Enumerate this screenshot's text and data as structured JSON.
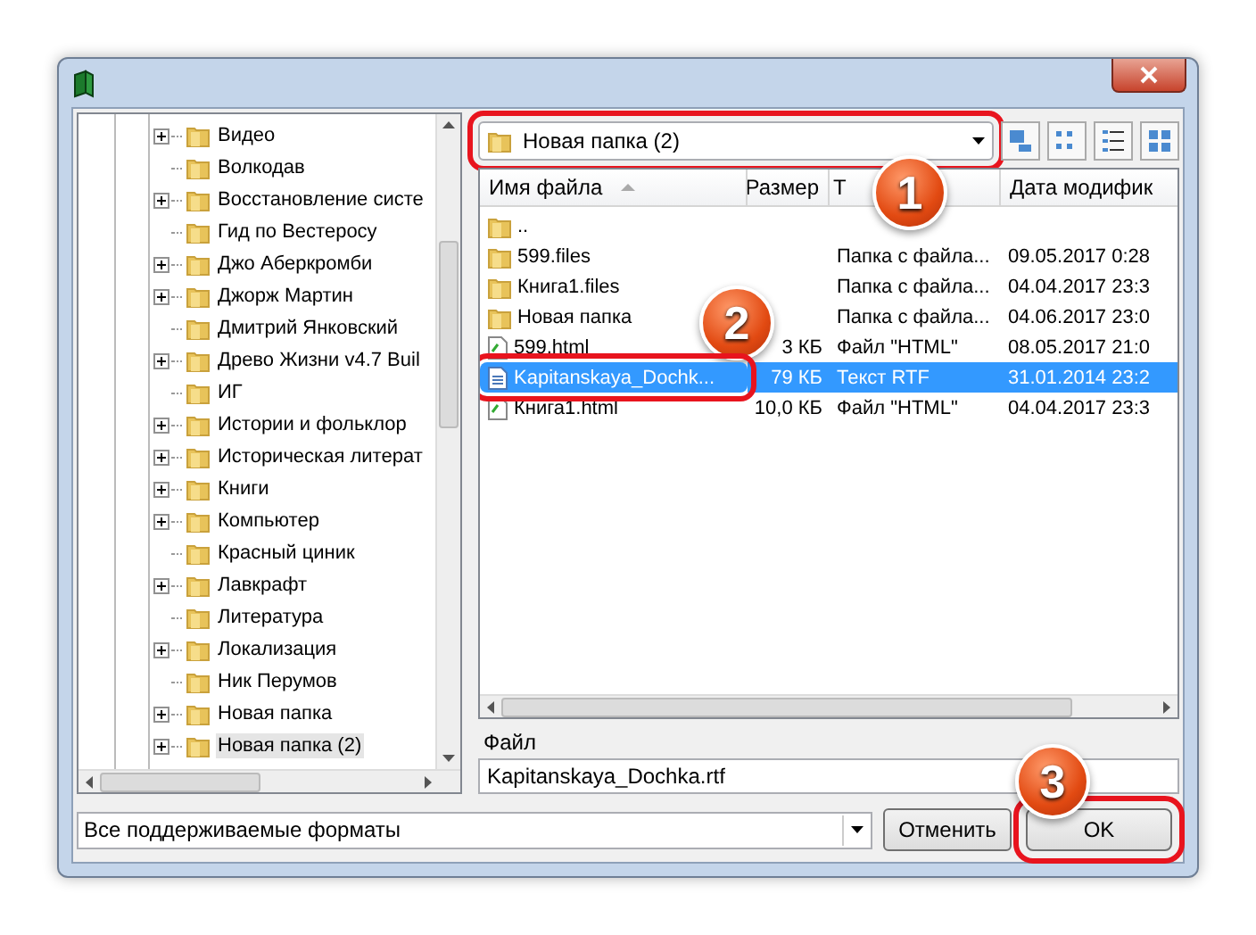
{
  "tree": {
    "items": [
      {
        "label": "Видео",
        "has_children": true,
        "selected": false
      },
      {
        "label": "Волкодав",
        "has_children": false,
        "selected": false
      },
      {
        "label": "Восстановление систе",
        "has_children": true,
        "selected": false
      },
      {
        "label": "Гид по Вестеросу",
        "has_children": false,
        "selected": false
      },
      {
        "label": "Джо Аберкромби",
        "has_children": true,
        "selected": false
      },
      {
        "label": "Джорж Мартин",
        "has_children": true,
        "selected": false
      },
      {
        "label": "Дмитрий Янковский",
        "has_children": false,
        "selected": false
      },
      {
        "label": "Древо Жизни v4.7 Buil",
        "has_children": true,
        "selected": false
      },
      {
        "label": "ИГ",
        "has_children": false,
        "selected": false
      },
      {
        "label": "Истории и фольклор",
        "has_children": true,
        "selected": false
      },
      {
        "label": "Историческая литерат",
        "has_children": true,
        "selected": false
      },
      {
        "label": "Книги",
        "has_children": true,
        "selected": false
      },
      {
        "label": "Компьютер",
        "has_children": true,
        "selected": false
      },
      {
        "label": "Красный циник",
        "has_children": false,
        "selected": false
      },
      {
        "label": "Лавкрафт",
        "has_children": true,
        "selected": false
      },
      {
        "label": "Литература",
        "has_children": false,
        "selected": false
      },
      {
        "label": "Локализация",
        "has_children": true,
        "selected": false
      },
      {
        "label": "Ник Перумов",
        "has_children": false,
        "selected": false
      },
      {
        "label": "Новая папка",
        "has_children": true,
        "selected": false
      },
      {
        "label": "Новая папка (2)",
        "has_children": true,
        "selected": true
      }
    ]
  },
  "location": {
    "value": "Новая папка (2)",
    "highlighted": true
  },
  "file_list": {
    "columns": [
      {
        "label": "Имя файла",
        "sorted": true
      },
      {
        "label": "Размер",
        "sorted": false
      },
      {
        "label": "Т",
        "sorted": false
      },
      {
        "label": "Дата модифик",
        "sorted": false
      }
    ],
    "rows": [
      {
        "kind": "folder",
        "name": "..",
        "selected": false,
        "highlighted": false
      },
      {
        "kind": "folder",
        "name": "599.files",
        "type": "Папка с файла...",
        "date": "09.05.2017 0:28",
        "selected": false,
        "highlighted": false
      },
      {
        "kind": "folder",
        "name": "Книга1.files",
        "type": "Папка с файла...",
        "date": "04.04.2017 23:3",
        "selected": false,
        "highlighted": false
      },
      {
        "kind": "folder",
        "name": "Новая папка",
        "type": "Папка с файла...",
        "date": "04.06.2017 23:0",
        "selected": false,
        "highlighted": false
      },
      {
        "kind": "html",
        "name": "599.html",
        "size": "3 КБ",
        "type": "Файл \"HTML\"",
        "date": "08.05.2017 21:0",
        "selected": false,
        "highlighted": false
      },
      {
        "kind": "rtf",
        "name": "Kapitanskaya_Dochk...",
        "size": "79 КБ",
        "type": "Текст RTF",
        "date": "31.01.2014 23:2",
        "selected": true,
        "highlighted": true
      },
      {
        "kind": "html",
        "name": "Книга1.html",
        "size": "10,0 КБ",
        "type": "Файл \"HTML\"",
        "date": "04.04.2017 23:3",
        "selected": false,
        "highlighted": false
      }
    ]
  },
  "file_name": {
    "label": "Файл",
    "value": "Kapitanskaya_Dochka.rtf"
  },
  "filter": {
    "value": "Все поддерживаемые форматы"
  },
  "buttons": [
    {
      "label": "Отменить",
      "highlighted": false
    },
    {
      "label": "OK",
      "highlighted": true
    }
  ],
  "callouts": [
    {
      "number": "1"
    },
    {
      "number": "2"
    },
    {
      "number": "3"
    }
  ]
}
